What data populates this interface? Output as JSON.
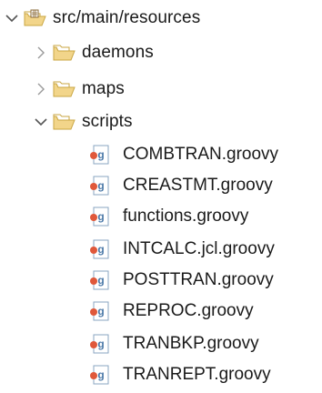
{
  "root": {
    "label": "src/main/resources",
    "expanded": true,
    "icon": "package-folder-icon"
  },
  "folders": [
    {
      "label": "daemons",
      "expanded": false,
      "icon": "folder-icon"
    },
    {
      "label": "maps",
      "expanded": false,
      "icon": "folder-icon"
    },
    {
      "label": "scripts",
      "expanded": true,
      "icon": "folder-icon"
    }
  ],
  "files": [
    {
      "label": "COMBTRAN.groovy",
      "icon": "groovy-file-icon"
    },
    {
      "label": "CREASTMT.groovy",
      "icon": "groovy-file-icon"
    },
    {
      "label": "functions.groovy",
      "icon": "groovy-file-icon"
    },
    {
      "label": "INTCALC.jcl.groovy",
      "icon": "groovy-file-icon"
    },
    {
      "label": "POSTTRAN.groovy",
      "icon": "groovy-file-icon"
    },
    {
      "label": "REPROC.groovy",
      "icon": "groovy-file-icon"
    },
    {
      "label": "TRANBKP.groovy",
      "icon": "groovy-file-icon"
    },
    {
      "label": "TRANREPT.groovy",
      "icon": "groovy-file-icon"
    }
  ],
  "colors": {
    "folder_fill": "#f2d58a",
    "folder_stroke": "#c9a642",
    "groovy_blue": "#4b79a8",
    "groovy_red": "#e0583a",
    "chevron": "#555555"
  }
}
